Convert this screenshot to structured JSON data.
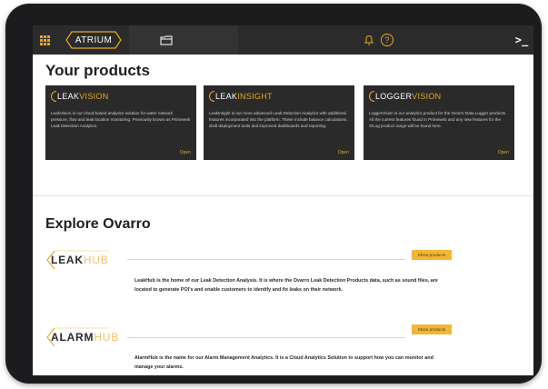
{
  "app": {
    "logo_text": "ATRIUM",
    "help_label": "?",
    "terminal_label": ">_"
  },
  "products": {
    "title": "Your products",
    "cards": [
      {
        "name_prefix": "LEAK",
        "name_suffix": "VISION",
        "description": "LeakVision is our cloud-based analytics solution for water network pressure, flow and leak location monitoring. Previously known as Primeweb Leak Detection Analytics.",
        "open_label": "Open"
      },
      {
        "name_prefix": "LEAK",
        "name_suffix": "INSIGHT",
        "description": "LeakInsight is our more advanced Leak Detection Analytics with additional features incorporated into the platform. These include balance calculations, draft deployment tools and improved dashboards and reporting.",
        "open_label": "Open"
      },
      {
        "name_prefix": "LOGGER",
        "name_suffix": "VISION",
        "description": "LoggerVision is our analytics product for the Ovarro Data Logger products. All the current features found in Primeweb and any new features for the XiLog product range will be found here.",
        "open_label": "Open"
      }
    ]
  },
  "explore": {
    "title": "Explore Ovarro",
    "hubs": [
      {
        "name_prefix": "LEAK",
        "name_suffix": "HUB",
        "button_label": "Show products",
        "description": "LeakHub is the home of our Leak Detection Analysis. It is where the Ovarro Leak Detection Products data, such as sound files, are located to generate POI's and enable customers to identify and fix leaks on their network."
      },
      {
        "name_prefix": "ALARM",
        "name_suffix": "HUB",
        "button_label": "Show products",
        "description": "AlarmHub is the name for our Alarm Management Analytics. It is a Cloud Analytics Solution to support how you can monitor and manage your alarms."
      }
    ]
  },
  "colors": {
    "accent": "#e9a820",
    "topbar": "#2b2b2b",
    "card": "#2a2a2a",
    "button": "#f2b632"
  }
}
